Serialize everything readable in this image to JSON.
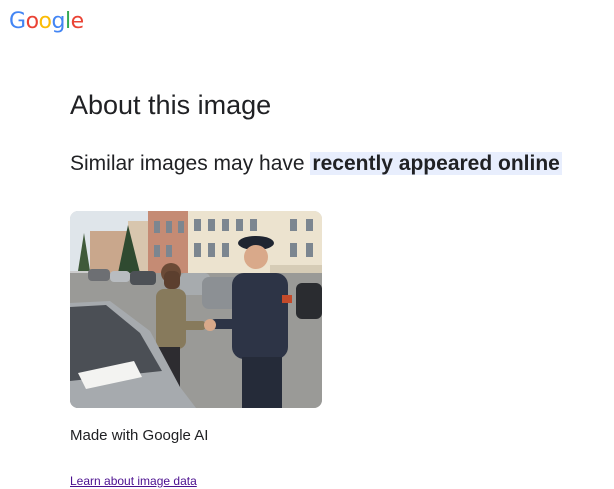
{
  "logo": {
    "letters": [
      "G",
      "o",
      "o",
      "g",
      "l",
      "e"
    ],
    "colors": [
      "#4285F4",
      "#EA4335",
      "#FBBC05",
      "#4285F4",
      "#34A853",
      "#EA4335"
    ]
  },
  "page": {
    "title": "About this image",
    "subtitle_prefix": "Similar images may have ",
    "subtitle_highlight": "recently appeared online",
    "highlight_color": "#e8eefd"
  },
  "image": {
    "alt": "Woman shaking hands with a police officer next to a parked car on a city street"
  },
  "caption": "Made with Google AI",
  "link": {
    "label": "Learn about image data",
    "color": "#4b0f8f"
  }
}
